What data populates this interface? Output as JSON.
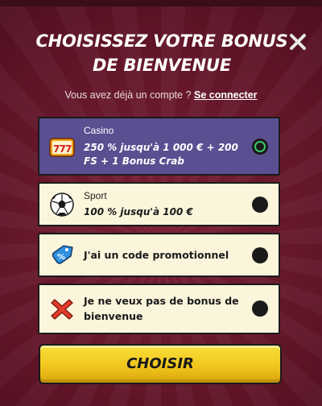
{
  "modal": {
    "title": "CHOISISSEZ VOTRE BONUS DE BIENVENUE",
    "account_prompt": "Vous avez déjà un compte ?",
    "login_link": "Se connecter"
  },
  "options": [
    {
      "label": "Casino",
      "description": "250 % jusqu'à 1 000 € + 200 FS + 1 Bonus Crab",
      "icon": "slot-777-icon",
      "selected": true
    },
    {
      "label": "Sport",
      "description": "100 % jusqu'à 100 €",
      "icon": "soccer-ball-icon",
      "selected": false
    },
    {
      "text": "J'ai un code promotionnel",
      "icon": "percent-tag-icon",
      "selected": false
    },
    {
      "text": "Je ne veux pas de bonus de bienvenue",
      "icon": "red-cross-icon",
      "selected": false
    }
  ],
  "cta": {
    "label": "CHOISIR"
  },
  "colors": {
    "background": "#6b1a2c",
    "selected_option": "#5a4f91",
    "option": "#fbf5dc",
    "cta": "#f1c71c",
    "radio_active_ring": "#3ec46d"
  }
}
